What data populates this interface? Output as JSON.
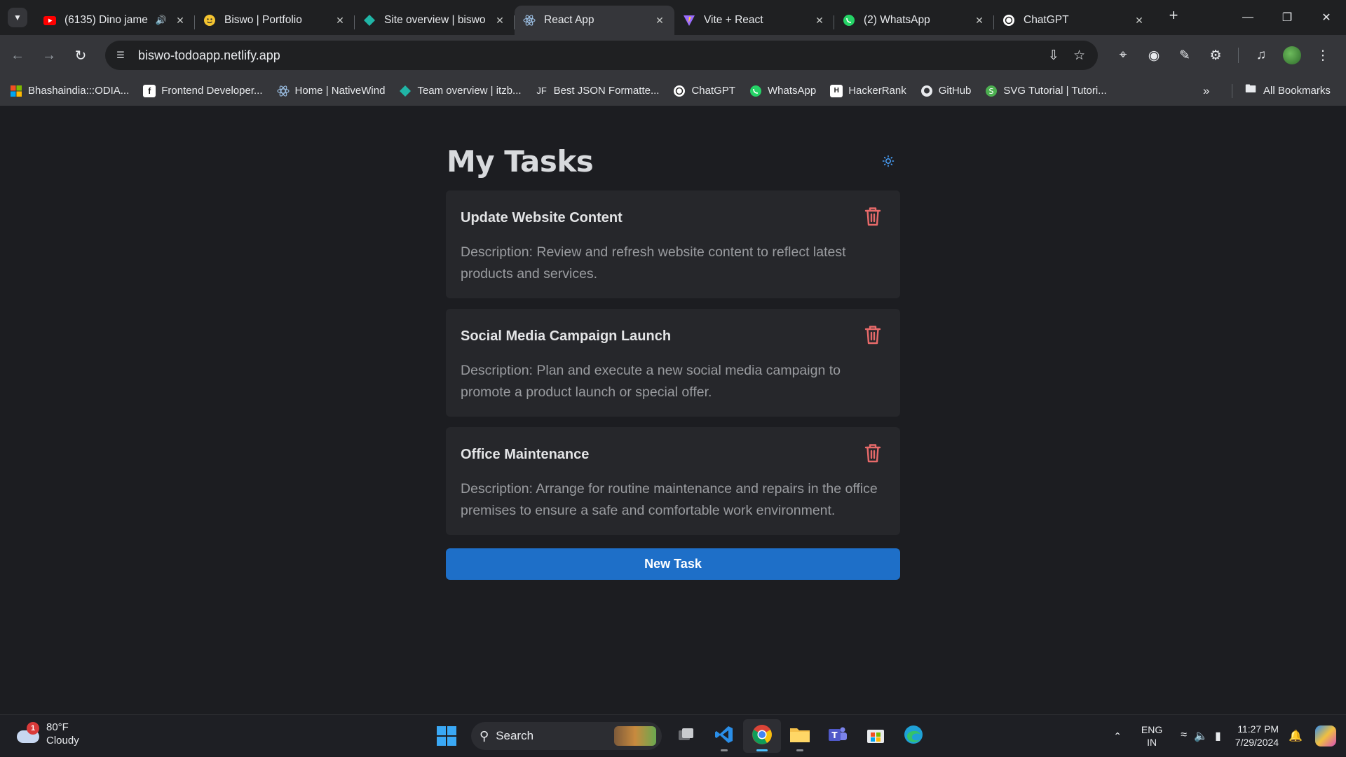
{
  "browser": {
    "tabs": [
      {
        "title": "(6135) Dino jame",
        "icon": "youtube-icon",
        "audio": true,
        "active": false
      },
      {
        "title": "Biswo | Portfolio",
        "icon": "portfolio-icon",
        "active": false
      },
      {
        "title": "Site overview | biswo",
        "icon": "netlify-icon",
        "active": false
      },
      {
        "title": "React App",
        "icon": "react-icon",
        "active": true
      },
      {
        "title": "Vite + React",
        "icon": "vite-icon",
        "active": false
      },
      {
        "title": "(2) WhatsApp",
        "icon": "whatsapp-icon",
        "active": false
      },
      {
        "title": "ChatGPT",
        "icon": "chatgpt-icon",
        "active": false
      }
    ],
    "url": "biswo-todoapp.netlify.app",
    "bookmarks": [
      {
        "label": "Bhashaindia:::ODIA...",
        "icon": "windows-icon"
      },
      {
        "label": "Frontend Developer...",
        "icon": "frontend-icon"
      },
      {
        "label": "Home | NativeWind",
        "icon": "react-icon"
      },
      {
        "label": "Team overview | itzb...",
        "icon": "netlify-icon"
      },
      {
        "label": "Best JSON Formatte...",
        "icon": "jf-icon",
        "icon_text": "JF"
      },
      {
        "label": "ChatGPT",
        "icon": "chatgpt-icon"
      },
      {
        "label": "WhatsApp",
        "icon": "whatsapp-icon"
      },
      {
        "label": "HackerRank",
        "icon": "hackerrank-icon"
      },
      {
        "label": "GitHub",
        "icon": "github-icon"
      },
      {
        "label": "SVG Tutorial | Tutori...",
        "icon": "svg-icon"
      }
    ],
    "all_bookmarks": "All Bookmarks"
  },
  "app": {
    "title": "My Tasks",
    "tasks": [
      {
        "title": "Update Website Content",
        "description": "Description: Review and refresh website content to reflect latest products and services."
      },
      {
        "title": "Social Media Campaign Launch",
        "description": "Description: Plan and execute a new social media campaign to promote a product launch or special offer."
      },
      {
        "title": "Office Maintenance",
        "description": "Description: Arrange for routine maintenance and repairs in the office premises to ensure a safe and comfortable work environment."
      }
    ],
    "new_task_label": "New Task"
  },
  "taskbar": {
    "weather": {
      "temp": "80°F",
      "condition": "Cloudy",
      "badge": "1"
    },
    "search_label": "Search",
    "lang_top": "ENG",
    "lang_bottom": "IN",
    "time": "11:27 PM",
    "date": "7/29/2024"
  },
  "colors": {
    "page_bg": "#1c1d21",
    "card_bg": "#26272b",
    "accent": "#1e6fc8",
    "delete": "#e86a6a",
    "theme_icon": "#4aa3ff"
  }
}
